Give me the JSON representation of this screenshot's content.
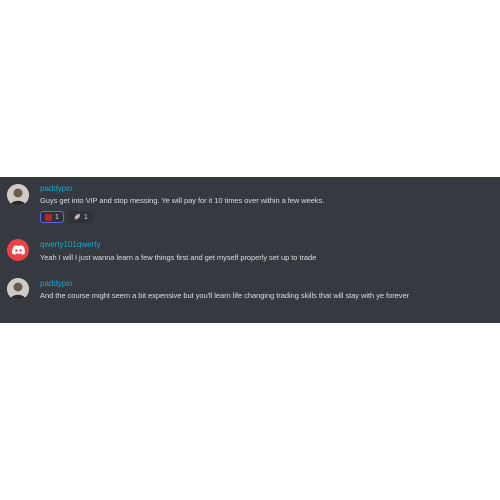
{
  "messages": [
    {
      "author": "paddypio",
      "avatar": "user-avatar-photo",
      "text": "Guys get into VIP and stop messing. Ye will pay for it 10 times over within a few weeks.",
      "reactions": [
        {
          "icon": "red-square-emoji",
          "count": "1"
        },
        {
          "icon": "rocket-emoji",
          "count": "1"
        }
      ]
    },
    {
      "author": "qwerty101qwerty",
      "avatar": "discord-logo-avatar",
      "text": "Yeah I will I just wanna learn a few things first and get myself properly set up to trade"
    },
    {
      "author": "paddypio",
      "avatar": "user-avatar-photo",
      "text": "And the course might seem a bit expensive but you'll learn life changing trading skills that will stay with ye forever"
    }
  ],
  "colors": {
    "panel_bg": "#36393f",
    "username": "#1ca8c9",
    "message_text": "#dcddde",
    "discord_red": "#ed4245",
    "reaction_border": "#5865f2"
  }
}
